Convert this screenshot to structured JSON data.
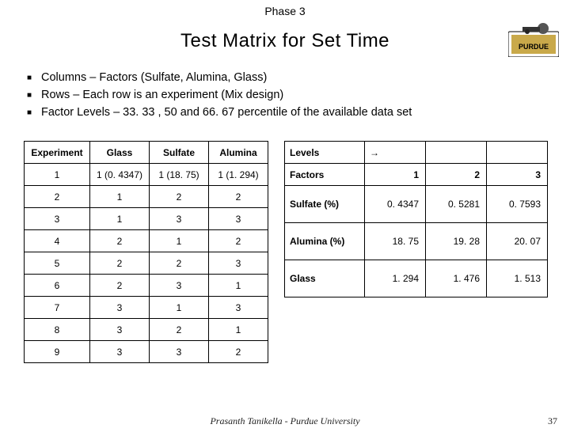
{
  "phase": "Phase 3",
  "title": "Test Matrix for Set Time",
  "bullets": [
    "Columns – Factors (Sulfate, Alumina, Glass)",
    "Rows – Each row is an experiment (Mix design)",
    "Factor Levels – 33. 33 , 50 and 66. 67 percentile of the available data set"
  ],
  "exp_table": {
    "headers": [
      "Experiment",
      "Glass",
      "Sulfate",
      "Alumina"
    ],
    "rows": [
      [
        "1",
        "1 (0. 4347)",
        "1 (18. 75)",
        "1 (1. 294)"
      ],
      [
        "2",
        "1",
        "2",
        "2"
      ],
      [
        "3",
        "1",
        "3",
        "3"
      ],
      [
        "4",
        "2",
        "1",
        "2"
      ],
      [
        "5",
        "2",
        "2",
        "3"
      ],
      [
        "6",
        "2",
        "3",
        "1"
      ],
      [
        "7",
        "3",
        "1",
        "3"
      ],
      [
        "8",
        "3",
        "2",
        "1"
      ],
      [
        "9",
        "3",
        "3",
        "2"
      ]
    ]
  },
  "lvl_table": {
    "corner_top": "Levels",
    "corner_arrow": "→",
    "corner_bottom": "Factors",
    "col_headers": [
      "1",
      "2",
      "3"
    ],
    "rows": [
      {
        "label": "Sulfate (%)",
        "vals": [
          "0. 4347",
          "0. 5281",
          "0. 7593"
        ]
      },
      {
        "label": "Alumina (%)",
        "vals": [
          "18. 75",
          "19. 28",
          "20. 07"
        ]
      },
      {
        "label": "Glass",
        "vals": [
          "1. 294",
          "1. 476",
          "1. 513"
        ]
      }
    ]
  },
  "footer": "Prasanth Tanikella - Purdue University",
  "pagenum": "37"
}
